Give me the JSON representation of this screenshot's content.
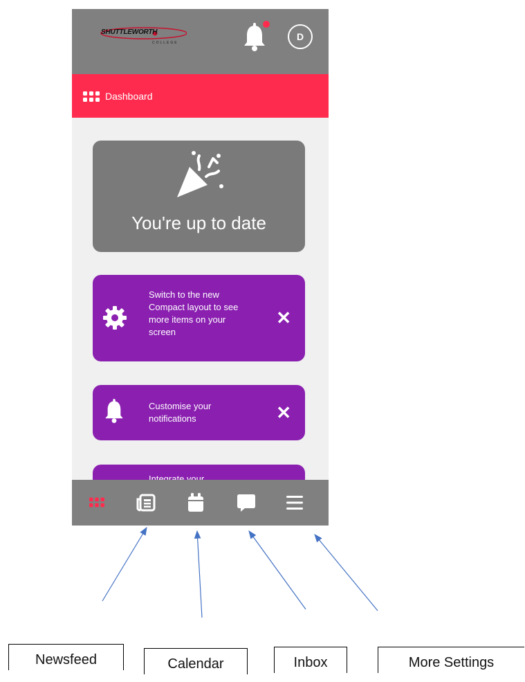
{
  "header": {
    "logo_name": "SHUTTLEWORTH",
    "logo_sub": "COLLEGE",
    "avatar_initial": "D",
    "has_notification": true
  },
  "section_bar": {
    "label": "Dashboard",
    "icon": "grid-icon"
  },
  "status_card": {
    "message": "You're up to date",
    "icon": "party-popper-icon"
  },
  "cards": [
    {
      "text": "Switch to the new Compact layout to see more items on your screen",
      "icon": "gear-icon",
      "close": "✕"
    },
    {
      "text": "Customise your notifications",
      "icon": "bell-icon",
      "close": "✕"
    },
    {
      "text": "Integrate your",
      "icon": ""
    }
  ],
  "bottom_nav": [
    {
      "name": "dashboard",
      "icon": "grid-icon",
      "active": true
    },
    {
      "name": "newsfeed",
      "icon": "newspaper-icon"
    },
    {
      "name": "calendar",
      "icon": "calendar-icon"
    },
    {
      "name": "inbox",
      "icon": "chat-icon"
    },
    {
      "name": "more",
      "icon": "menu-icon"
    }
  ],
  "callouts": [
    "Newsfeed",
    "Calendar",
    "Inbox",
    "More Settings"
  ],
  "colors": {
    "topbar": "#808080",
    "accent": "#ff2b4e",
    "card_purple": "#8a1fb0",
    "card_grey": "#7a7a7a"
  }
}
